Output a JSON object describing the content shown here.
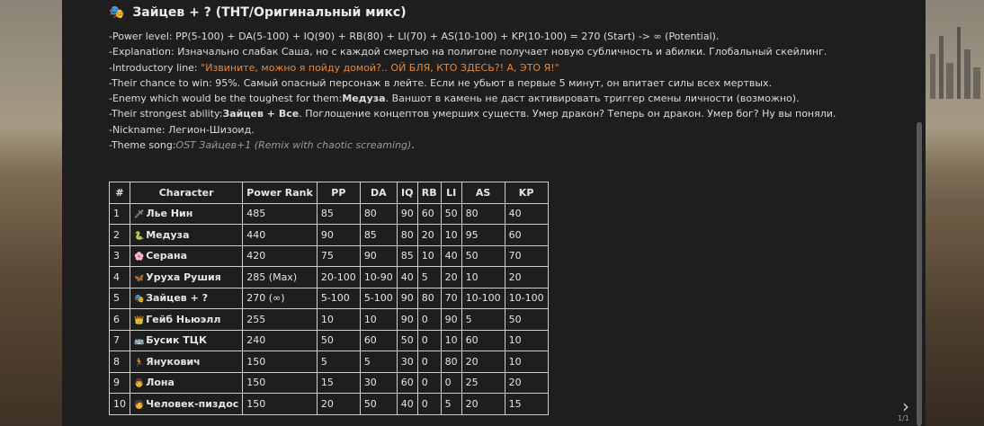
{
  "header": {
    "emoji": "🎭",
    "title": "Зайцев + ? (ТНТ/Оригинальный микс)"
  },
  "lines": {
    "power_level": "-Power level: PP(5-100) + DA(5-100) + IQ(90) + RB(80) + LI(70) + AS(10-100) + KP(10-100) = 270 (Start) -> ∞ (Potential).",
    "explanation": "-Explanation: Изначально слабак Саша, но с каждой смертью на полигоне получает новую субличность и абилки. Глобальный скейлинг.",
    "intro_label": "-Introductory line: ",
    "intro_quote": "\"Извините, можно я пойду домой?.. ОЙ БЛЯ, КТО ЗДЕСЬ?! А, ЭТО Я!\"",
    "win_chance": "-Their chance to win: 95%. Самый опасный персонаж в лейте. Если не убьют в первые 5 минут, он впитает силы всех мертвых.",
    "enemy_label": "-Enemy which would be the toughest for them:",
    "enemy_name": "Медуза",
    "enemy_rest": ". Ваншот в камень не даст активировать триггер смены личности (возможно).",
    "ability_label": "-Their strongest ability:",
    "ability_name": "Зайцев + Все",
    "ability_rest": ". Поглощение концептов умерших существ. Умер дракон? Теперь он дракон. Умер бог? Ну вы поняли.",
    "nickname": "-Nickname: Легион-Шизоид.",
    "theme_label": "-Theme song:",
    "theme_song": "OST Зайцев+1 (Remix with chaotic screaming)",
    "theme_end": "."
  },
  "table": {
    "headers": [
      "#",
      "Character",
      "Power Rank",
      "PP",
      "DA",
      "IQ",
      "RB",
      "LI",
      "AS",
      "KP"
    ],
    "rows": [
      {
        "n": "1",
        "emoji": "🗡",
        "name": "Лье Нин",
        "rank": "485",
        "pp": "85",
        "da": "80",
        "iq": "90",
        "rb": "60",
        "li": "50",
        "as": "80",
        "kp": "40"
      },
      {
        "n": "2",
        "emoji": "🐍",
        "name": "Медуза",
        "rank": "440",
        "pp": "90",
        "da": "85",
        "iq": "80",
        "rb": "20",
        "li": "10",
        "as": "95",
        "kp": "60"
      },
      {
        "n": "3",
        "emoji": "🌸",
        "name": "Серана",
        "rank": "420",
        "pp": "75",
        "da": "90",
        "iq": "85",
        "rb": "10",
        "li": "40",
        "as": "50",
        "kp": "70"
      },
      {
        "n": "4",
        "emoji": "🦋",
        "name": "Уруха Рушия",
        "rank": "285 (Max)",
        "pp": "20-100",
        "da": "10-90",
        "iq": "40",
        "rb": "5",
        "li": "20",
        "as": "10",
        "kp": "20"
      },
      {
        "n": "5",
        "emoji": "🎭",
        "name": "Зайцев + ?",
        "rank": "270 (∞)",
        "pp": "5-100",
        "da": "5-100",
        "iq": "90",
        "rb": "80",
        "li": "70",
        "as": "10-100",
        "kp": "10-100"
      },
      {
        "n": "6",
        "emoji": "👑",
        "name": "Гейб Ньюэлл",
        "rank": "255",
        "pp": "10",
        "da": "10",
        "iq": "90",
        "rb": "0",
        "li": "90",
        "as": "5",
        "kp": "50"
      },
      {
        "n": "7",
        "emoji": "🚌",
        "name": "Бусик ТЦК",
        "rank": "240",
        "pp": "50",
        "da": "60",
        "iq": "50",
        "rb": "0",
        "li": "10",
        "as": "60",
        "kp": "10"
      },
      {
        "n": "8",
        "emoji": "🏃",
        "name": "Янукович",
        "rank": "150",
        "pp": "5",
        "da": "5",
        "iq": "30",
        "rb": "0",
        "li": "80",
        "as": "20",
        "kp": "10"
      },
      {
        "n": "9",
        "emoji": "👨",
        "name": "Лона",
        "rank": "150",
        "pp": "15",
        "da": "30",
        "iq": "60",
        "rb": "0",
        "li": "0",
        "as": "25",
        "kp": "20"
      },
      {
        "n": "10",
        "emoji": "🧑",
        "name": "Человек-пиздос",
        "rank": "150",
        "pp": "20",
        "da": "50",
        "iq": "40",
        "rb": "0",
        "li": "5",
        "as": "20",
        "kp": "15"
      }
    ]
  },
  "pager": {
    "next_icon": "chevron-right-icon",
    "label": "1/1"
  },
  "colors": {
    "panel": "#1e1e1e",
    "accent_quote": "#e8893a",
    "muted": "#9a9a9a"
  }
}
